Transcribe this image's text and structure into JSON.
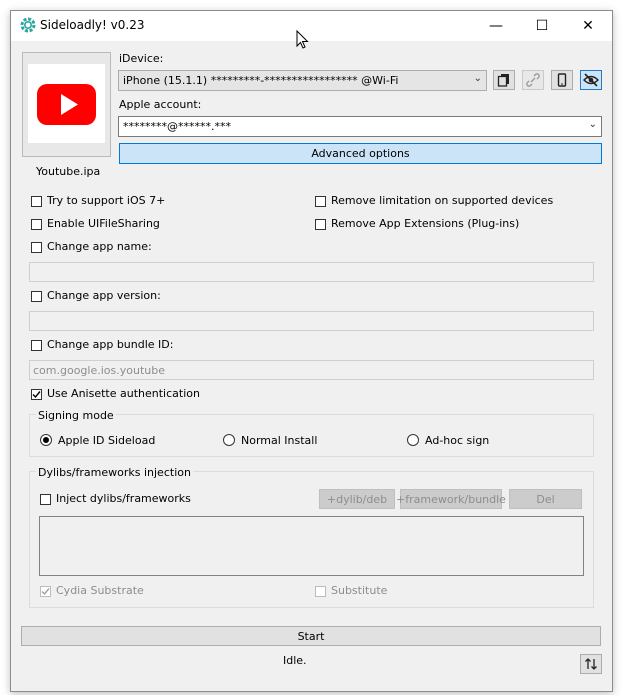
{
  "window": {
    "title": "Sideloadly! v0.23",
    "controls": {
      "minimize": "—",
      "maximize": "☐",
      "close": "✕"
    }
  },
  "app_file": {
    "name": "Youtube.ipa",
    "icon": "youtube-logo",
    "brand_color": "#ff0000"
  },
  "idevice": {
    "label": "iDevice:",
    "value": "iPhone (15.1.1) *********-***************** @Wi-Fi",
    "buttons": [
      "copy-icon",
      "unlink-icon",
      "phone-icon",
      "hide-icon"
    ]
  },
  "apple_account": {
    "label": "Apple account:",
    "value": "********@******.***"
  },
  "advanced_button": "Advanced options",
  "options": {
    "try_ios7": {
      "label": "Try to support iOS 7+",
      "checked": false
    },
    "remove_limitation": {
      "label": "Remove limitation on supported devices",
      "checked": false
    },
    "file_sharing": {
      "label": "Enable UIFileSharing",
      "checked": false
    },
    "remove_extensions": {
      "label": "Remove App Extensions (Plug-ins)",
      "checked": false
    },
    "change_name": {
      "label": "Change app name:",
      "checked": false,
      "value": ""
    },
    "change_version": {
      "label": "Change app version:",
      "checked": false,
      "value": ""
    },
    "change_bundle": {
      "label": "Change app bundle ID:",
      "checked": false,
      "placeholder": "com.google.ios.youtube"
    },
    "anisette": {
      "label": "Use Anisette authentication",
      "checked": true
    }
  },
  "signing": {
    "title": "Signing mode",
    "modes": [
      {
        "label": "Apple ID Sideload",
        "selected": true
      },
      {
        "label": "Normal Install",
        "selected": false
      },
      {
        "label": "Ad-hoc sign",
        "selected": false
      }
    ]
  },
  "dylibs": {
    "title": "Dylibs/frameworks injection",
    "inject_label": "Inject dylibs/frameworks",
    "add_dylib": "+dylib/deb",
    "add_framework": "+framework/bundle",
    "delete": "Del",
    "cydia": "Cydia Substrate",
    "substitute": "Substitute"
  },
  "start_button": "Start",
  "status": "Idle.",
  "sort_icon": "swap-vertical-icon"
}
